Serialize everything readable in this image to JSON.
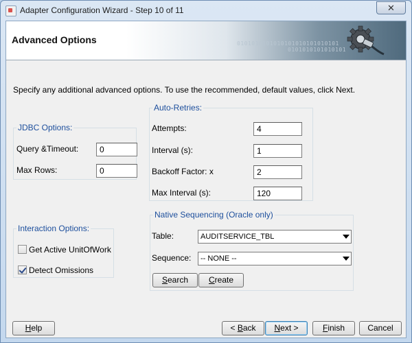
{
  "window": {
    "title": "Adapter Configuration Wizard - Step 10 of 11",
    "close_glyph": "✕"
  },
  "banner": {
    "title": "Advanced Options",
    "binary_line1": "0101010101010101010101010101",
    "binary_line2": "0101010101010101"
  },
  "instructions": "Specify any additional advanced options.  To use the recommended, default values, click Next.",
  "jdbc": {
    "legend": "JDBC Options:",
    "query_timeout_label": "Query &Timeout:",
    "query_timeout_value": "0",
    "max_rows_label": "Max Rows:",
    "max_rows_value": "0"
  },
  "auto_retries": {
    "legend": "Auto-Retries:",
    "attempts_label": "Attempts:",
    "attempts_value": "4",
    "interval_label": "Interval (s):",
    "interval_value": "1",
    "backoff_label": "Backoff Factor: x",
    "backoff_value": "2",
    "max_interval_label": "Max Interval (s):",
    "max_interval_value": "120"
  },
  "interaction": {
    "legend": "Interaction Options:",
    "get_active_label": "Get Active UnitOfWork",
    "get_active_checked": false,
    "detect_omissions_label": "Detect Omissions",
    "detect_omissions_checked": true
  },
  "native_sequencing": {
    "legend": "Native Sequencing (Oracle only)",
    "table_label": "Table:",
    "table_value": "AUDITSERVICE_TBL",
    "sequence_label": "Sequence:",
    "sequence_value": "-- NONE --",
    "search_m": "S",
    "search_rest": "earch",
    "create_m": "C",
    "create_rest": "reate"
  },
  "footer": {
    "help_m": "H",
    "help_rest": "elp",
    "back_pre": "< ",
    "back_m": "B",
    "back_rest": "ack",
    "next_m": "N",
    "next_rest": "ext >",
    "finish_m": "F",
    "finish_rest": "inish",
    "cancel_label": "Cancel"
  },
  "colors": {
    "legend_text": "#1c4e9c",
    "default_button_border": "#3c7fb1"
  }
}
